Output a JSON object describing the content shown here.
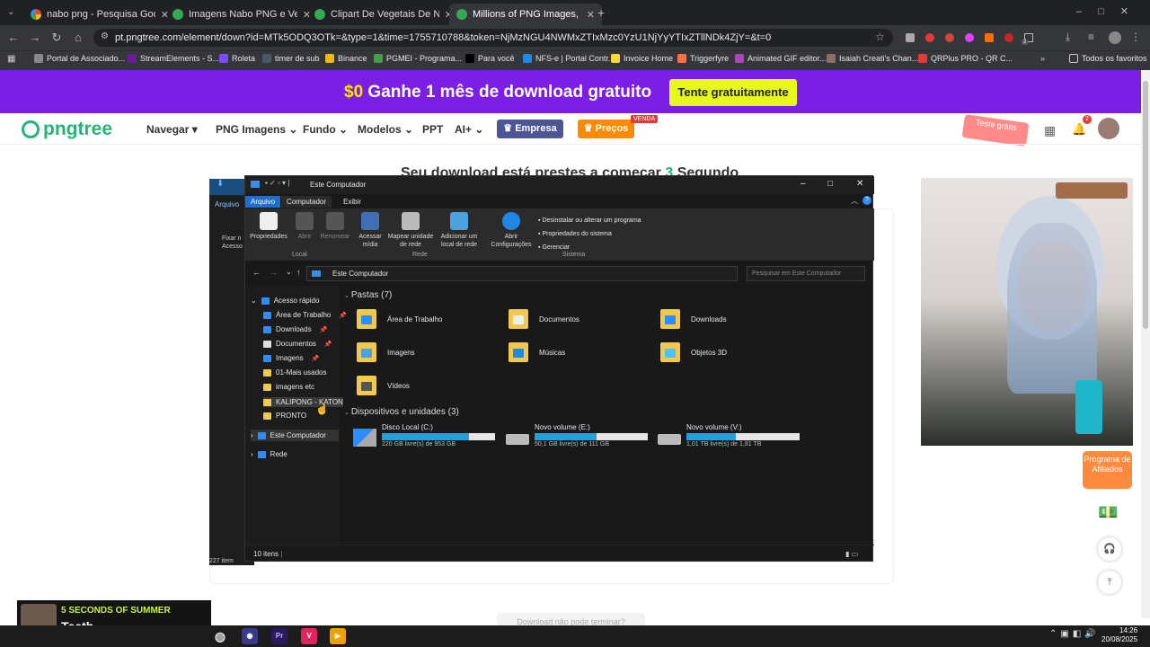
{
  "browser": {
    "tabs": [
      {
        "title": "nabo png - Pesquisa Google"
      },
      {
        "title": "Imagens Nabo PNG e Vetor, co"
      },
      {
        "title": "Clipart De Vegetais De Nabo 3"
      },
      {
        "title": "Millions of PNG Images, Backg"
      }
    ],
    "url": "pt.pngtree.com/element/down?id=MTk5ODQ3OTk=&type=1&time=1755710788&token=NjMzNGU4NWMxZTIxMzc0YzU1NjYyYTIxZTllNDk4ZjY=&t=0",
    "bookmarks": [
      "Portal de Associado...",
      "StreamElements - S...",
      "Roleta",
      "timer de sub",
      "Binance",
      "PGMEI - Programa...",
      "Para você",
      "NFS-e | Portal Contr...",
      "Invoice Home",
      "Triggerfyre",
      "Animated GIF editor...",
      "Isaiah Creati's Chan...",
      "QRPlus PRO - QR C..."
    ],
    "all_bookmarks": "Todos os favoritos",
    "ext_badge": "2"
  },
  "promo": {
    "prefix": "$0",
    "text": " Ganhe 1 mês de download gratuito",
    "button": "Tente gratuitamente"
  },
  "site": {
    "logo": "pngtree",
    "menu": [
      "Navegar ▾",
      "PNG Imagens",
      "Fundo",
      "Modelos",
      "PPT",
      "AI+"
    ],
    "empresa": "Empresa",
    "precos": "Preços",
    "venda": "VENDA",
    "teste": "Teste grátis",
    "bell_count": "2",
    "download_title_a": "Seu download está prestes a começar",
    "download_count": "3",
    "download_title_b": "Segundo",
    "affiliate": "Programa de Afiliados",
    "cannot_download": "Download não pode terminar?"
  },
  "explorer": {
    "title": "Este Computador",
    "ribbon_tabs": [
      "Arquivo",
      "Computador",
      "Exibir"
    ],
    "ribbon_buttons": [
      "Propriedades",
      "Abrir",
      "Renomear",
      "Acessar mídia",
      "Mapear unidade de rede",
      "Adicionar um local de rede",
      "Abrir Configurações"
    ],
    "system_links": [
      "Desinstalar ou alterar um programa",
      "Propriedades do sistema",
      "Gerenciar"
    ],
    "groups": [
      "Local",
      "Rede",
      "Sistema"
    ],
    "path": "Este Computador",
    "search_placeholder": "Pesquisar em Este Computador",
    "nav": [
      "Acesso rápido",
      "Área de Trabalho",
      "Downloads",
      "Documentos",
      "Imagens",
      "01-Mais usados",
      "imagens etc",
      "KALIPONG - KATON",
      "PRONTO",
      "Este Computador",
      "Rede"
    ],
    "folders_header": "Pastas (7)",
    "folders": [
      "Área de Trabalho",
      "Documentos",
      "Downloads",
      "Imagens",
      "Músicas",
      "Objetos 3D",
      "Vídeos"
    ],
    "drives_header": "Dispositivos e unidades (3)",
    "drives": [
      {
        "name": "Disco Local (C:)",
        "free": "220 GB livre(s) de 953 GB",
        "used_fraction": 0.77
      },
      {
        "name": "Novo volume (E:)",
        "free": "50,1 GB livre(s) de 111 GB",
        "used_fraction": 0.55
      },
      {
        "name": "Novo volume (V:)",
        "free": "1,01 TB livre(s) de 1,81 TB",
        "used_fraction": 0.44
      }
    ],
    "status": "10 itens",
    "ghost_status": "227 item",
    "ghost_tab": "Arquivo",
    "ghost_text": "Fixar n Acesso rá"
  },
  "music": {
    "artist": "5 SECONDS OF SUMMER",
    "song": "Teeth"
  },
  "taskbar": {
    "time": "14:26",
    "date": "20/08/2025"
  }
}
